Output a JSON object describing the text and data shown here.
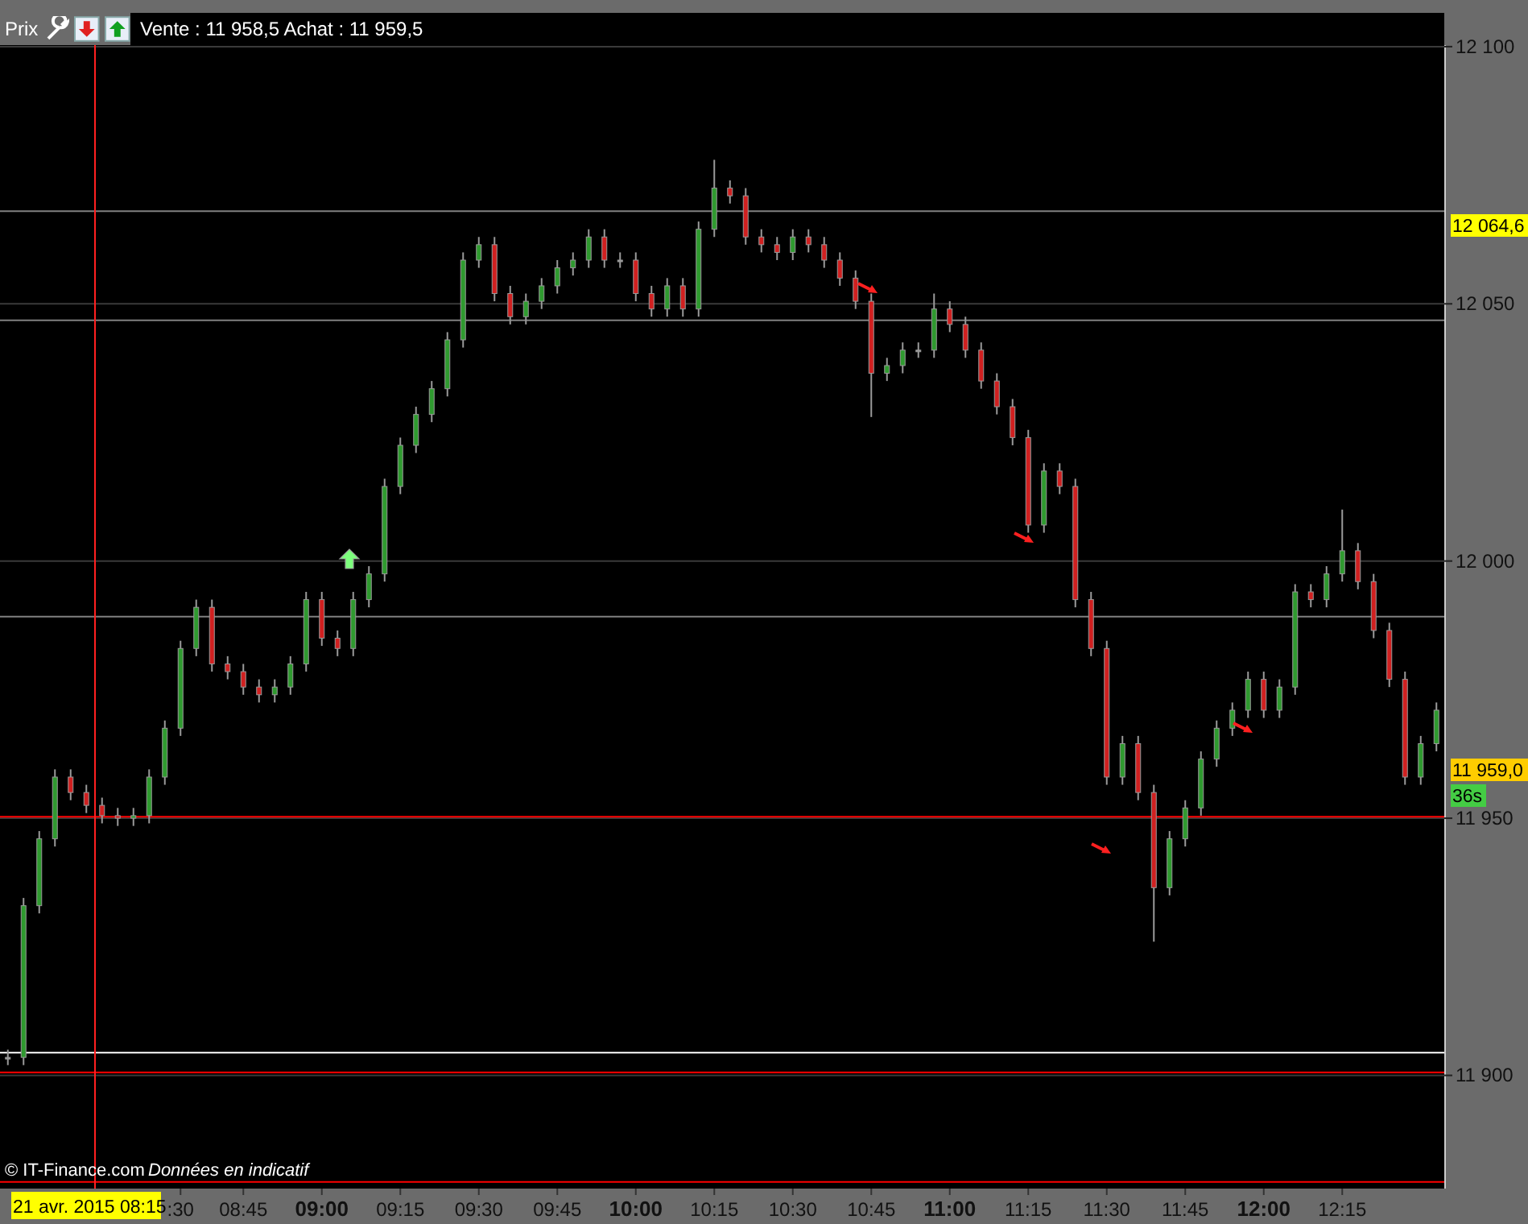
{
  "toolbar": {
    "label": "Prix",
    "quote": "Vente : 11 958,5 Achat : 11 959,5"
  },
  "chart": {
    "signals": [
      {
        "kind": "sell"
      },
      {
        "kind": "sell"
      },
      {
        "kind": "sell"
      },
      {
        "kind": "sell"
      },
      {
        "kind": "buy"
      }
    ],
    "chart_data": {
      "type": "candlestick",
      "ylim": [
        11878,
        12100.3
      ],
      "grid": true,
      "categories": [
        null,
        null,
        null,
        null,
        null,
        null,
        null,
        null,
        null,
        null,
        null,
        ":30",
        null,
        null,
        null,
        "08:45",
        null,
        null,
        null,
        null,
        "09:00",
        null,
        null,
        null,
        null,
        "09:15",
        null,
        null,
        null,
        null,
        "09:30",
        null,
        null,
        null,
        null,
        "09:45",
        null,
        null,
        null,
        null,
        "10:00",
        null,
        null,
        null,
        null,
        "10:15",
        null,
        null,
        null,
        null,
        "10:30",
        null,
        null,
        null,
        null,
        "10:45",
        null,
        null,
        null,
        null,
        "11:00",
        null,
        null,
        null,
        null,
        "11:15",
        null,
        null,
        null,
        null,
        "11:30",
        null,
        null,
        null,
        null,
        "11:45",
        null,
        null,
        null,
        null,
        "12:00",
        null,
        null,
        null,
        null,
        "12:15",
        null,
        null,
        null,
        null,
        null,
        null
      ],
      "ohlc": [
        [
          11903.5,
          11905,
          11902,
          11903.5
        ],
        [
          11903.5,
          11934.5,
          11902,
          11933
        ],
        [
          11933,
          11947.5,
          11931.5,
          11946
        ],
        [
          11946,
          11959.5,
          11944.5,
          11958
        ],
        [
          11958,
          11959.5,
          11953.5,
          11955
        ],
        [
          11955,
          11956.5,
          11951,
          11952.5
        ],
        [
          11952.5,
          11954,
          11949,
          11950.5
        ],
        [
          11950.5,
          11952,
          11948.5,
          11950
        ],
        [
          11950,
          11952,
          11948.5,
          11950.5
        ],
        [
          11950.5,
          11959.5,
          11949,
          11958
        ],
        [
          11958,
          11969,
          11956.5,
          11967.5
        ],
        [
          11967.5,
          11984.5,
          11966,
          11983
        ],
        [
          11983,
          11992.5,
          11981.5,
          11991
        ],
        [
          11991,
          11992.5,
          11978.5,
          11980
        ],
        [
          11980,
          11981.5,
          11977,
          11978.5
        ],
        [
          11978.5,
          11980,
          11974,
          11975.5
        ],
        [
          11975.5,
          11977,
          11972.5,
          11974
        ],
        [
          11974,
          11977,
          11972.5,
          11975.5
        ],
        [
          11975.5,
          11981.5,
          11974,
          11980
        ],
        [
          11980,
          11994,
          11978.5,
          11992.5
        ],
        [
          11992.5,
          11994,
          11983.5,
          11985
        ],
        [
          11985,
          11986.5,
          11981.5,
          11983
        ],
        [
          11983,
          11994,
          11981.5,
          11992.5
        ],
        [
          11992.5,
          11999,
          11991,
          11997.5
        ],
        [
          11997.5,
          12016,
          11996,
          12014.5
        ],
        [
          12014.5,
          12024,
          12013,
          12022.5
        ],
        [
          12022.5,
          12030,
          12021,
          12028.5
        ],
        [
          12028.5,
          12035,
          12027,
          12033.5
        ],
        [
          12033.5,
          12044.5,
          12032,
          12043
        ],
        [
          12043,
          12060,
          12041.5,
          12058.5
        ],
        [
          12058.5,
          12063,
          12057,
          12061.5
        ],
        [
          12061.5,
          12063,
          12050.5,
          12052
        ],
        [
          12052,
          12053.5,
          12046,
          12047.5
        ],
        [
          12047.5,
          12052,
          12046,
          12050.5
        ],
        [
          12050.5,
          12055,
          12049,
          12053.5
        ],
        [
          12053.5,
          12058.5,
          12052,
          12057
        ],
        [
          12057,
          12060,
          12055.5,
          12058.5
        ],
        [
          12058.5,
          12064.5,
          12057,
          12063
        ],
        [
          12063,
          12064.5,
          12057,
          12058.5
        ],
        [
          12058.5,
          12060,
          12057,
          12058.5
        ],
        [
          12058.5,
          12060,
          12050.5,
          12052
        ],
        [
          12052,
          12053.5,
          12047.5,
          12049
        ],
        [
          12049,
          12055,
          12047.5,
          12053.5
        ],
        [
          12053.5,
          12055,
          12047.5,
          12049
        ],
        [
          12049,
          12066,
          12047.5,
          12064.5
        ],
        [
          12064.5,
          12078,
          12063,
          12072.5
        ],
        [
          12072.5,
          12074,
          12069.5,
          12071
        ],
        [
          12071,
          12072.5,
          12061.5,
          12063
        ],
        [
          12063,
          12064.5,
          12060,
          12061.5
        ],
        [
          12061.5,
          12063,
          12058.5,
          12060
        ],
        [
          12060,
          12064.5,
          12058.5,
          12063
        ],
        [
          12063,
          12064.5,
          12060,
          12061.5
        ],
        [
          12061.5,
          12063,
          12057,
          12058.5
        ],
        [
          12058.5,
          12060,
          12053.5,
          12055
        ],
        [
          12055,
          12056.5,
          12049,
          12050.5
        ],
        [
          12050.5,
          12052,
          12028,
          12036.5
        ],
        [
          12036.5,
          12039.5,
          12035,
          12038
        ],
        [
          12038,
          12042.5,
          12036.5,
          12041
        ],
        [
          12041,
          12042.5,
          12039.5,
          12041
        ],
        [
          12041,
          12052,
          12039.5,
          12049
        ],
        [
          12049,
          12050.5,
          12044.5,
          12046
        ],
        [
          12046,
          12047.5,
          12039.5,
          12041
        ],
        [
          12041,
          12042.5,
          12033.5,
          12035
        ],
        [
          12035,
          12036.5,
          12028.5,
          12030
        ],
        [
          12030,
          12031.5,
          12022.5,
          12024
        ],
        [
          12024,
          12025.5,
          12005.5,
          12007
        ],
        [
          12007,
          12019,
          12005.5,
          12017.5
        ],
        [
          12017.5,
          12019,
          12013,
          12014.5
        ],
        [
          12014.5,
          12016,
          11991,
          11992.5
        ],
        [
          11992.5,
          11994,
          11981.5,
          11983
        ],
        [
          11983,
          11984.5,
          11956.5,
          11958
        ],
        [
          11958,
          11966,
          11956.5,
          11964.5
        ],
        [
          11964.5,
          11966,
          11953.5,
          11955
        ],
        [
          11955,
          11956.5,
          11926,
          11936.5
        ],
        [
          11936.5,
          11947.5,
          11935,
          11946
        ],
        [
          11946,
          11953.5,
          11944.5,
          11952
        ],
        [
          11952,
          11963,
          11950.5,
          11961.5
        ],
        [
          11961.5,
          11969,
          11960,
          11967.5
        ],
        [
          11967.5,
          11972.5,
          11966,
          11971
        ],
        [
          11971,
          11978.5,
          11969.5,
          11977
        ],
        [
          11977,
          11978.5,
          11969.5,
          11971
        ],
        [
          11971,
          11977,
          11969.5,
          11975.5
        ],
        [
          11975.5,
          11995.5,
          11974,
          11994
        ],
        [
          11994,
          11995.5,
          11991,
          11992.5
        ],
        [
          11992.5,
          11999,
          11991,
          11997.5
        ],
        [
          11997.5,
          12010,
          11996,
          12002
        ],
        [
          12002,
          12003.5,
          11994.5,
          11996
        ],
        [
          11996,
          11997.5,
          11985,
          11986.5
        ],
        [
          11986.5,
          11988,
          11975.5,
          11977
        ],
        [
          11977,
          11978.5,
          11956.5,
          11958
        ],
        [
          11958,
          11966,
          11956.5,
          11964.5
        ],
        [
          11964.5,
          11972.5,
          11963,
          11971
        ]
      ],
      "yticks": [
        {
          "value": 12100,
          "label": "12 100"
        },
        {
          "value": 12050,
          "label": "12 050"
        },
        {
          "value": 12000,
          "label": "12 000"
        },
        {
          "value": 11950,
          "label": "11 950"
        },
        {
          "value": 11900,
          "label": "11 900"
        }
      ],
      "ref_lines": [
        {
          "axis": "y",
          "value": 12068,
          "color": "#808080"
        },
        {
          "axis": "y",
          "value": 12046.8,
          "color": "#808080"
        },
        {
          "axis": "y",
          "value": 11989.2,
          "color": "#808080"
        },
        {
          "axis": "y",
          "value": 11950.3,
          "color": "#ff0000"
        },
        {
          "axis": "y",
          "value": 11904.4,
          "color": "#ffffff"
        },
        {
          "axis": "y",
          "value": 11900.6,
          "color": "#ff0000"
        },
        {
          "axis": "y",
          "value": 11879.3,
          "color": "#ff0000"
        }
      ],
      "annotations": [
        "21 avr. 2015 08:15",
        "12 064,6",
        "11 959,0",
        "36s"
      ]
    }
  },
  "footer": {
    "copyright": "© IT-Finance.com",
    "disclaimer": "Données en indicatif"
  }
}
